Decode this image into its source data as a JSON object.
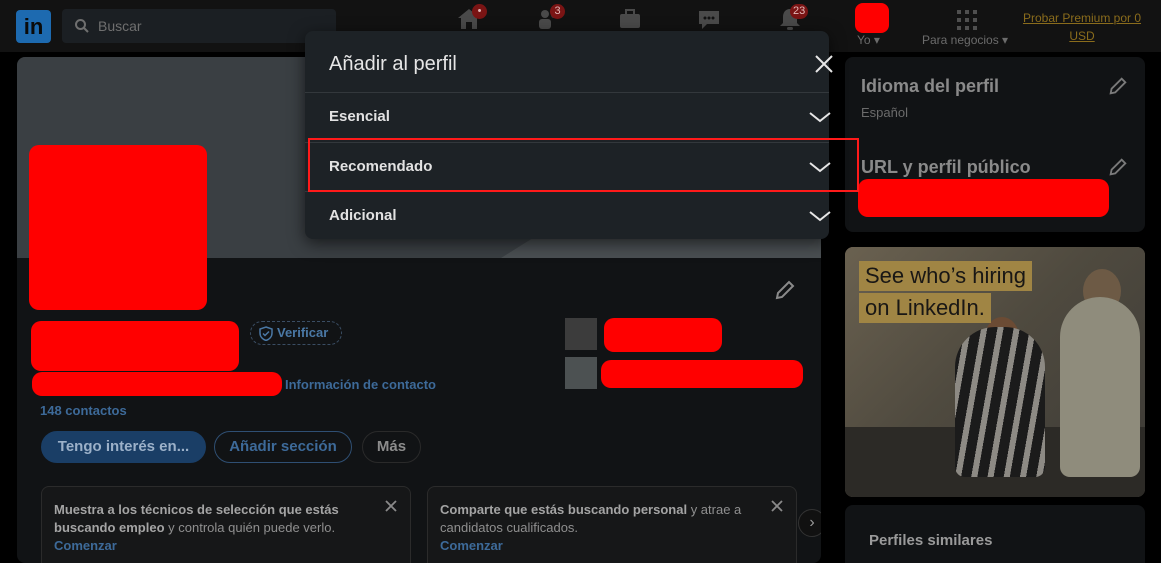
{
  "nav": {
    "logo_text": "in",
    "search_placeholder": "Buscar",
    "badges": {
      "home": "•",
      "network": "3",
      "notifications": "23"
    },
    "me_label": "Yo",
    "business_label": "Para negocios",
    "premium_link": "Probar Premium por 0 USD"
  },
  "profile": {
    "verify_label": "Verificar",
    "contact_info": "Información de contacto",
    "connections": "148 contactos",
    "buttons": {
      "open_to": "Tengo interés en...",
      "add_section": "Añadir sección",
      "more": "Más"
    },
    "cards": [
      {
        "bold": "Muestra a los técnicos de selección que estás buscando empleo",
        "rest": " y controla quién puede verlo.",
        "action": "Comenzar"
      },
      {
        "bold": "Comparte que estás buscando personal",
        "rest": " y atrae a candidatos cualificados.",
        "action": "Comenzar"
      }
    ],
    "next_arrow": "›"
  },
  "sidebar": {
    "language_title": "Idioma del perfil",
    "language_value": "Español",
    "url_title": "URL y perfil público",
    "ad_line1": "See who’s hiring",
    "ad_line2": "on LinkedIn.",
    "similar_profiles": "Perfiles similares"
  },
  "modal": {
    "title": "Añadir al perfil",
    "sections": [
      {
        "label": "Esencial"
      },
      {
        "label": "Recomendado"
      },
      {
        "label": "Adicional"
      }
    ]
  },
  "colors": {
    "modal_bg": "#1d2226",
    "highlight": "#ff1a1a",
    "redaction": "#ff0000",
    "link": "#3d6a99"
  }
}
